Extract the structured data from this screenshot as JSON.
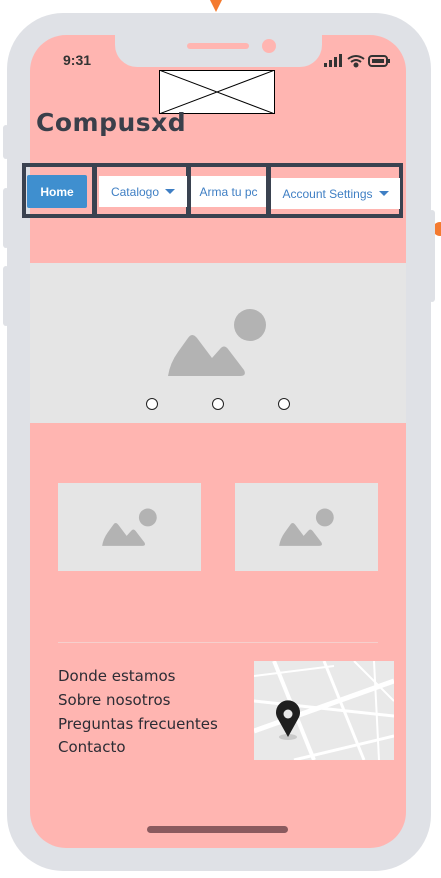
{
  "status_bar": {
    "time": "9:31"
  },
  "header": {
    "brand": "Compusxd",
    "logo_icon": "image-placeholder-icon"
  },
  "nav": {
    "home": "Home",
    "catalogo": "Catalogo",
    "arma_tu_pc": "Arma tu pc",
    "account_settings": "Account Settings"
  },
  "carousel": {
    "icon": "image-icon",
    "slides": 3
  },
  "cards": [
    {
      "icon": "image-icon"
    },
    {
      "icon": "image-icon"
    }
  ],
  "footer": {
    "links": [
      "Donde estamos",
      "Sobre nosotros",
      "Preguntas frecuentes",
      "Contacto"
    ],
    "map_icon": "map-pin-icon"
  },
  "colors": {
    "screen_bg": "#ffb5b1",
    "frame": "#dfe1e6",
    "nav_border": "#3a4250",
    "accent": "#3f8fcf",
    "link": "#3f7fc4",
    "placeholder": "#e5e5e5",
    "placeholder_icon": "#b3b3b3"
  }
}
